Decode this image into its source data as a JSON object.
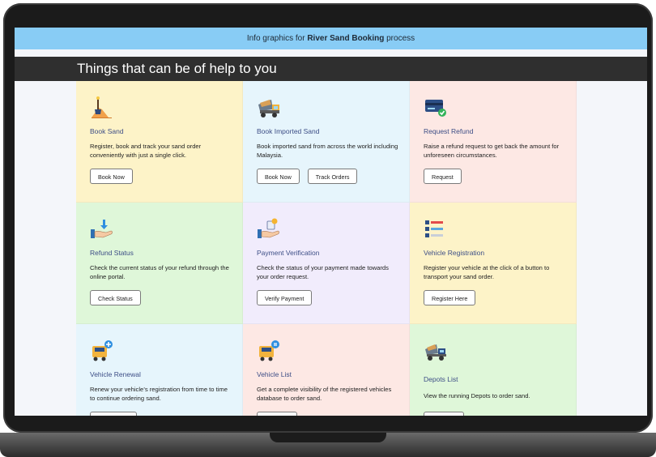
{
  "banner": {
    "prefix": "Info graphics for ",
    "strong": "River Sand Booking",
    "suffix": " process"
  },
  "help": {
    "title": "Things that can be of help to you"
  },
  "cards": [
    {
      "title": "Book Sand",
      "desc": "Register, book and track your sand order conveniently with just a single click.",
      "buttons": [
        "Book Now"
      ],
      "icon": "sand-pile-shovel-icon"
    },
    {
      "title": "Book Imported Sand",
      "desc": "Book imported sand from across the world including Malaysia.",
      "buttons": [
        "Book Now",
        "Track Orders"
      ],
      "icon": "dump-truck-icon"
    },
    {
      "title": "Request Refund",
      "desc": "Raise a refund request to get back the amount for unforeseen circumstances.",
      "buttons": [
        "Request"
      ],
      "icon": "card-check-icon"
    },
    {
      "title": "Refund Status",
      "desc": "Check the current status of your refund through the online portal.",
      "buttons": [
        "Check Status"
      ],
      "icon": "hand-receive-icon"
    },
    {
      "title": "Payment Verification",
      "desc": "Check the status of your payment made towards your order request.",
      "buttons": [
        "Verify Payment"
      ],
      "icon": "hand-payment-icon"
    },
    {
      "title": "Vehicle Registration",
      "desc": "Register your vehicle at the click of a button to transport your sand order.",
      "buttons": [
        "Register Here"
      ],
      "icon": "checklist-icon"
    },
    {
      "title": "Vehicle Renewal",
      "desc": "Renew your vehicle’s registration from time to time to continue ordering sand.",
      "buttons": [
        ""
      ],
      "icon": "truck-add-icon"
    },
    {
      "title": "Vehicle List",
      "desc": "Get a complete visibility of the registered vehicles database to order sand.",
      "buttons": [
        ""
      ],
      "icon": "truck-list-icon"
    },
    {
      "title": "Depots List",
      "desc": "View the running Depots to order sand.",
      "buttons": [
        ""
      ],
      "icon": "depot-truck-icon"
    }
  ]
}
